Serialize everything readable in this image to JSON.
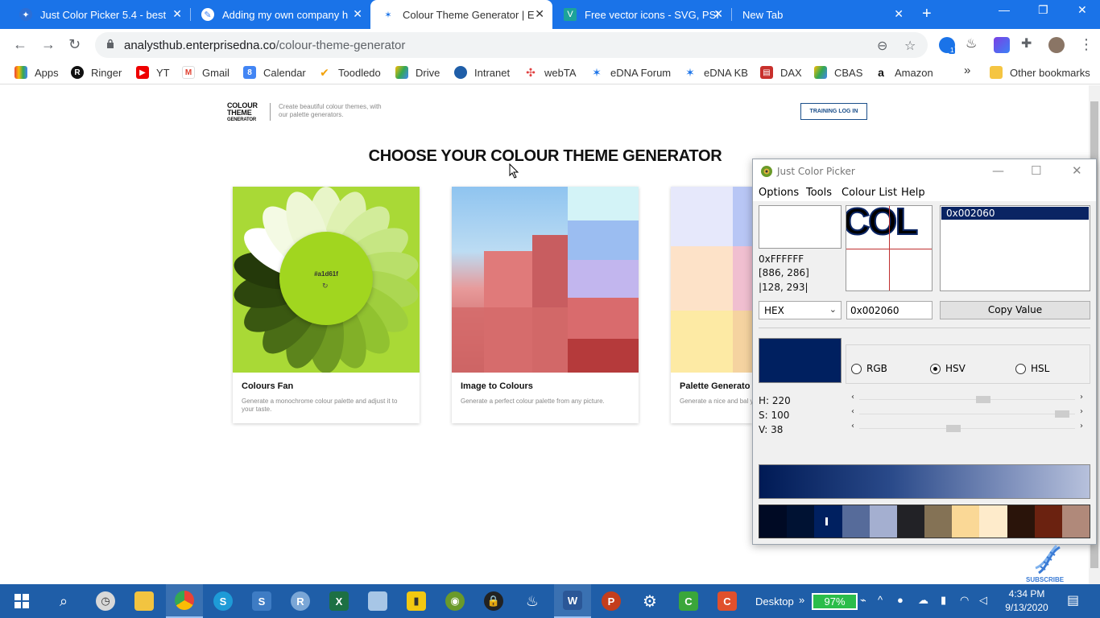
{
  "browser": {
    "tabs": [
      {
        "title": "Just Color Picker 5.4 - best",
        "icon_color": "#2c6ed5"
      },
      {
        "title": "Adding my own company h",
        "icon_color": "#3b82f6"
      },
      {
        "title": "Colour Theme Generator | E",
        "icon_color": "#1a73e8"
      },
      {
        "title": "Free vector icons - SVG, PSI",
        "icon_color": "#1ca39a"
      },
      {
        "title": "New Tab",
        "icon_color": ""
      }
    ],
    "url_host": "analysthub.enterprisedna.co",
    "url_path": "/colour-theme-generator",
    "bookmarks": [
      "Apps",
      "Ringer",
      "YT",
      "Gmail",
      "Calendar",
      "Toodledo",
      "Drive",
      "Intranet",
      "webTA",
      "eDNA Forum",
      "eDNA KB",
      "DAX",
      "CBAS",
      "Amazon"
    ],
    "other_bookmarks": "Other bookmarks",
    "more": "»",
    "badge": "1"
  },
  "page": {
    "logo_line1": "COLOUR",
    "logo_line2": "THEME",
    "logo_line3": "GENERATOR",
    "tagline": "Create beautiful colour themes, with our palette generators.",
    "training_button": "TRAINING LOG IN",
    "heading": "CHOOSE YOUR COLOUR THEME GENERATOR",
    "cards": [
      {
        "title": "Colours Fan",
        "desc": "Generate a monochrome colour palette and adjust it to your taste.",
        "hex": "#a1d61f"
      },
      {
        "title": "Image to Colours",
        "desc": "Generate a perfect colour palette from any picture."
      },
      {
        "title": "Palette Generato",
        "desc": "Generate a nice and bal your most artistic proje"
      }
    ]
  },
  "picker": {
    "title": "Just Color Picker",
    "menu": [
      "Options",
      "Tools",
      "Colour List",
      "Help"
    ],
    "current_value": "0xFFFFFF",
    "coords1": "[886, 286]",
    "coords2": "|128, 293|",
    "magnifier_text": "COL",
    "list_items": [
      "0x002060"
    ],
    "format": "HEX",
    "value_input": "0x002060",
    "copy_button": "Copy Value",
    "modes": [
      "RGB",
      "HSV",
      "HSL"
    ],
    "selected_mode": "HSV",
    "h": "H: 220",
    "s": "S: 100",
    "v": "V: 38",
    "h_level": 0.58,
    "s_level": 0.97,
    "v_level": 0.43,
    "main_color": "#002060",
    "palette": [
      "#000a24",
      "#001233",
      "#002060",
      "#566b9a",
      "#a4afd0",
      "#222226",
      "#847255",
      "#fad896",
      "#feebcb",
      "#2a140a",
      "#6b2210",
      "#b0897a"
    ]
  },
  "subscribe": "SUBSCRIBE",
  "taskbar": {
    "desktop_label": "Desktop",
    "battery": "97%",
    "time": "4:34 PM",
    "date": "9/13/2020"
  }
}
